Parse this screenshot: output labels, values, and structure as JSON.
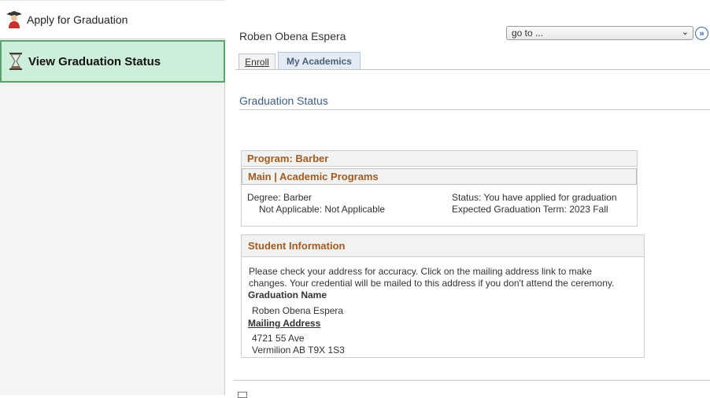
{
  "sidebar": {
    "items": [
      {
        "label": "Apply for Graduation",
        "icon": "graduate-icon"
      },
      {
        "label": "View Graduation Status",
        "icon": "hourglass-icon"
      }
    ]
  },
  "header": {
    "student_name": "Roben Obena Espera",
    "goto_value": "go to ...",
    "goto_button_icon": "double-chevron-right-icon"
  },
  "tabs": [
    {
      "label": "Enroll",
      "active": false
    },
    {
      "label": "My Academics",
      "active": true
    }
  ],
  "section": {
    "title": "Graduation Status"
  },
  "program": {
    "title": "Program: Barber",
    "subheading": "Main | Academic Programs",
    "degree": "Degree: Barber",
    "not_applicable": "Not Applicable: Not Applicable",
    "status": "Status: You have applied for graduation",
    "expected_term": "Expected Graduation Term: 2023 Fall"
  },
  "student_info": {
    "title": "Student Information",
    "instructions_line1": "Please check your address for accuracy. Click on the mailing address link to make",
    "instructions_line2": "changes. Your credential will be mailed to this address if you don't attend the ceremony.",
    "graduation_name_label": "Graduation Name",
    "graduation_name": "Roben Obena Espera",
    "mailing_address_label": "Mailing Address",
    "address_line1": "4721 55 Ave",
    "address_line2": "Vermilion AB T9X 1S3"
  },
  "colors": {
    "accent_orange": "#a35a1e",
    "link_blue": "#3c5d86",
    "selected_green": "#cdeed8"
  }
}
